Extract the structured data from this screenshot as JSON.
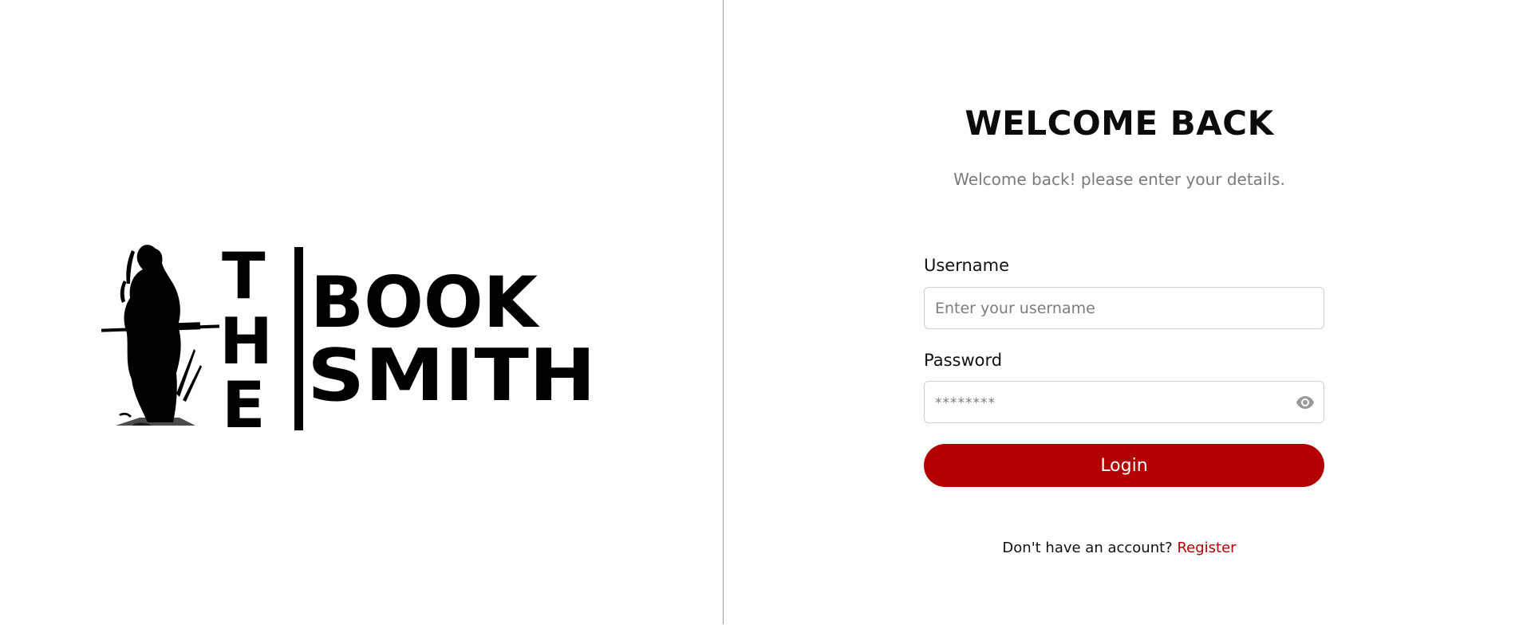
{
  "brand": {
    "logo_alt": "THE BOOK SMITH",
    "logo_letters": {
      "vertical": [
        "T",
        "H",
        "E"
      ],
      "top_word": "BOOK",
      "bottom_word": "SMITH"
    }
  },
  "login_form": {
    "title": "WELCOME BACK",
    "subtitle": "Welcome back! please enter your details.",
    "username": {
      "label": "Username",
      "placeholder": "Enter your username",
      "value": ""
    },
    "password": {
      "label": "Password",
      "placeholder": "********",
      "value": "",
      "toggle_icon": "eye-icon"
    },
    "submit_label": "Login",
    "footer": {
      "prompt": "Don't have an account?",
      "link_label": "Register"
    }
  },
  "colors": {
    "accent": "#b30000",
    "divider": "#9a9a9a",
    "muted_text": "#7a7a7a"
  }
}
